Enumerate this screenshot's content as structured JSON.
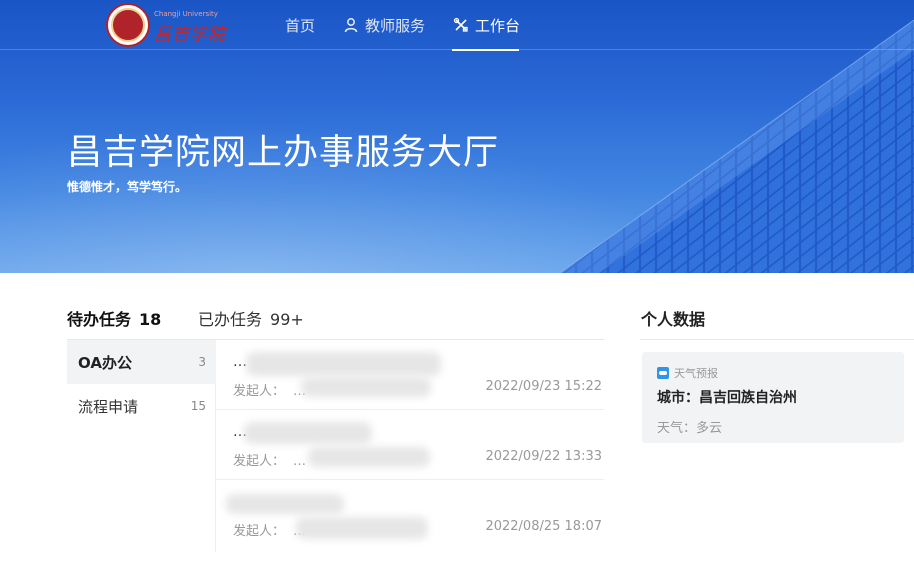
{
  "header": {
    "logo_small_text": "Changji University",
    "logo_text": "昌吉学院",
    "nav": {
      "home": "首页",
      "teacher_service": "教师服务",
      "workbench": "工作台"
    }
  },
  "hero": {
    "title": "昌吉学院网上办事服务大厅",
    "subtitle": "惟德惟才，笃学笃行。"
  },
  "tasks": {
    "tab_pending": {
      "label": "待办任务",
      "count": "18"
    },
    "tab_done": {
      "label": "已办任务",
      "count": "99+"
    },
    "categories": [
      {
        "label": "OA办公",
        "count": "3"
      },
      {
        "label": "流程申请",
        "count": "15"
      }
    ],
    "items": [
      {
        "title": "…",
        "initiator_label": "发起人：",
        "initiator": "…",
        "date": "2022/09/23 15:22"
      },
      {
        "title": "…",
        "initiator_label": "发起人：",
        "initiator": "…",
        "date": "2022/09/22 13:33"
      },
      {
        "title": "…",
        "initiator_label": "发起人：",
        "initiator": "…",
        "date": "2022/08/25 18:07"
      }
    ]
  },
  "personal": {
    "title": "个人数据",
    "weather_tag": "天气预报",
    "city_line": "城市：昌吉回族自治州",
    "weather_line": "天气：多云"
  },
  "colors": {
    "hero_blue": "#1a55c5",
    "logo_red": "#b0232a"
  }
}
